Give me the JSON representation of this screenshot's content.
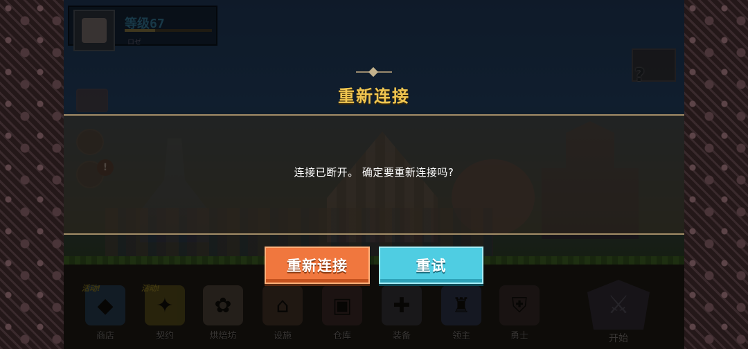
{
  "player": {
    "level_label": "等级67",
    "sub_label": "ロゼ",
    "xp_fraction": 0.35
  },
  "dialog": {
    "title": "重新连接",
    "message": "连接已断开。 确定要重新连接吗?",
    "reconnect_label": "重新连接",
    "retry_label": "重试"
  },
  "sidebar": {
    "alert_symbol": "!"
  },
  "help": {
    "symbol": "?"
  },
  "bottom_nav": {
    "items": [
      {
        "label": "商店",
        "badge": "活动!",
        "icon": "shop-icon",
        "color": "#2d5f8a"
      },
      {
        "label": "契约",
        "badge": "活动!",
        "icon": "contract-icon",
        "color": "#8a7a20"
      },
      {
        "label": "烘焙坊",
        "badge": "",
        "icon": "bakery-icon",
        "color": "#7a6a5a"
      },
      {
        "label": "设施",
        "badge": "",
        "icon": "facility-icon",
        "color": "#6a4a3a"
      },
      {
        "label": "仓库",
        "badge": "",
        "icon": "warehouse-icon",
        "color": "#5a3a3a"
      },
      {
        "label": "装备",
        "badge": "",
        "icon": "equipment-icon",
        "color": "#4a4a5a"
      },
      {
        "label": "领主",
        "badge": "",
        "icon": "lord-icon",
        "color": "#3a4a7a"
      },
      {
        "label": "勇士",
        "badge": "",
        "icon": "warrior-icon",
        "color": "#4a3a3a"
      }
    ],
    "start_label": "开始"
  }
}
